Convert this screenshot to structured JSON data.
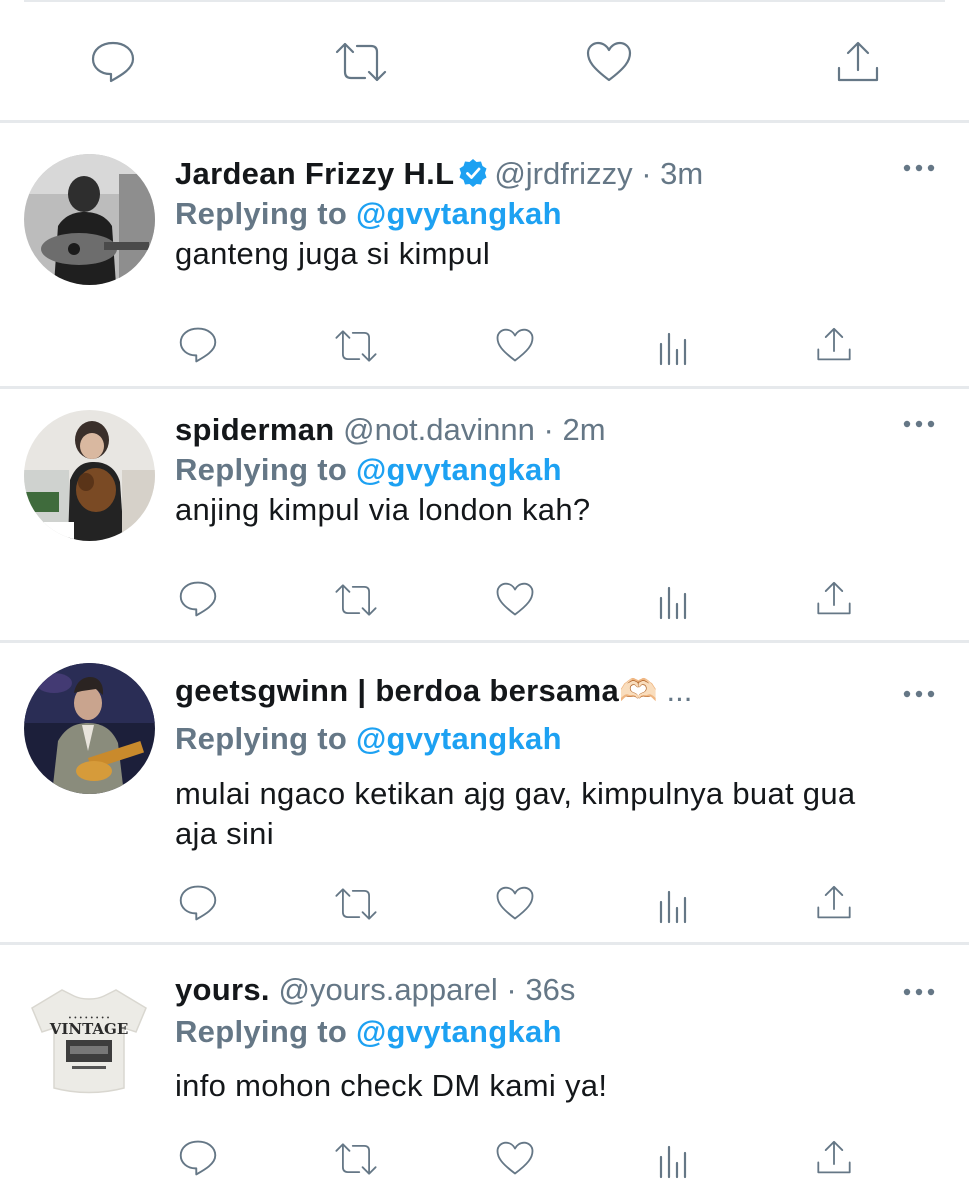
{
  "colors": {
    "accent": "#1da1f2",
    "secondary_text": "#657786",
    "divider": "#e6e9ec"
  },
  "top_actions": [
    "reply-icon",
    "retweet-icon",
    "like-icon",
    "share-icon"
  ],
  "tweets": [
    {
      "name": "Jardean Frizzy H.L",
      "verified": true,
      "handle": "@jrdfrizzy",
      "separator": " · ",
      "time": "3m",
      "replying_label": "Replying to",
      "replying_to": "@gvytangkah",
      "text": "ganteng juga si kimpul",
      "more": "···"
    },
    {
      "name": "spiderman",
      "verified": false,
      "handle": "@not.davinnn",
      "separator": " · ",
      "time": "2m",
      "replying_label": "Replying to",
      "replying_to": "@gvytangkah",
      "text": "anjing kimpul via london kah?",
      "more": "···"
    },
    {
      "name": "geetsgwinn | berdoa bersama🫶🏻",
      "verified": false,
      "handle": "...",
      "separator": "",
      "time": "",
      "replying_label": "Replying to",
      "replying_to": "@gvytangkah",
      "text": "mulai ngaco ketikan ajg gav, kimpulnya buat gua aja sini",
      "more": "···"
    },
    {
      "name": "yours.",
      "verified": false,
      "handle": "@yours.apparel",
      "separator": " · ",
      "time": "36s",
      "replying_label": "Replying to",
      "replying_to": "@gvytangkah",
      "text": "info mohon check DM kami ya!",
      "more": "···",
      "avatar_shirt_text": "VINTAGE"
    }
  ]
}
